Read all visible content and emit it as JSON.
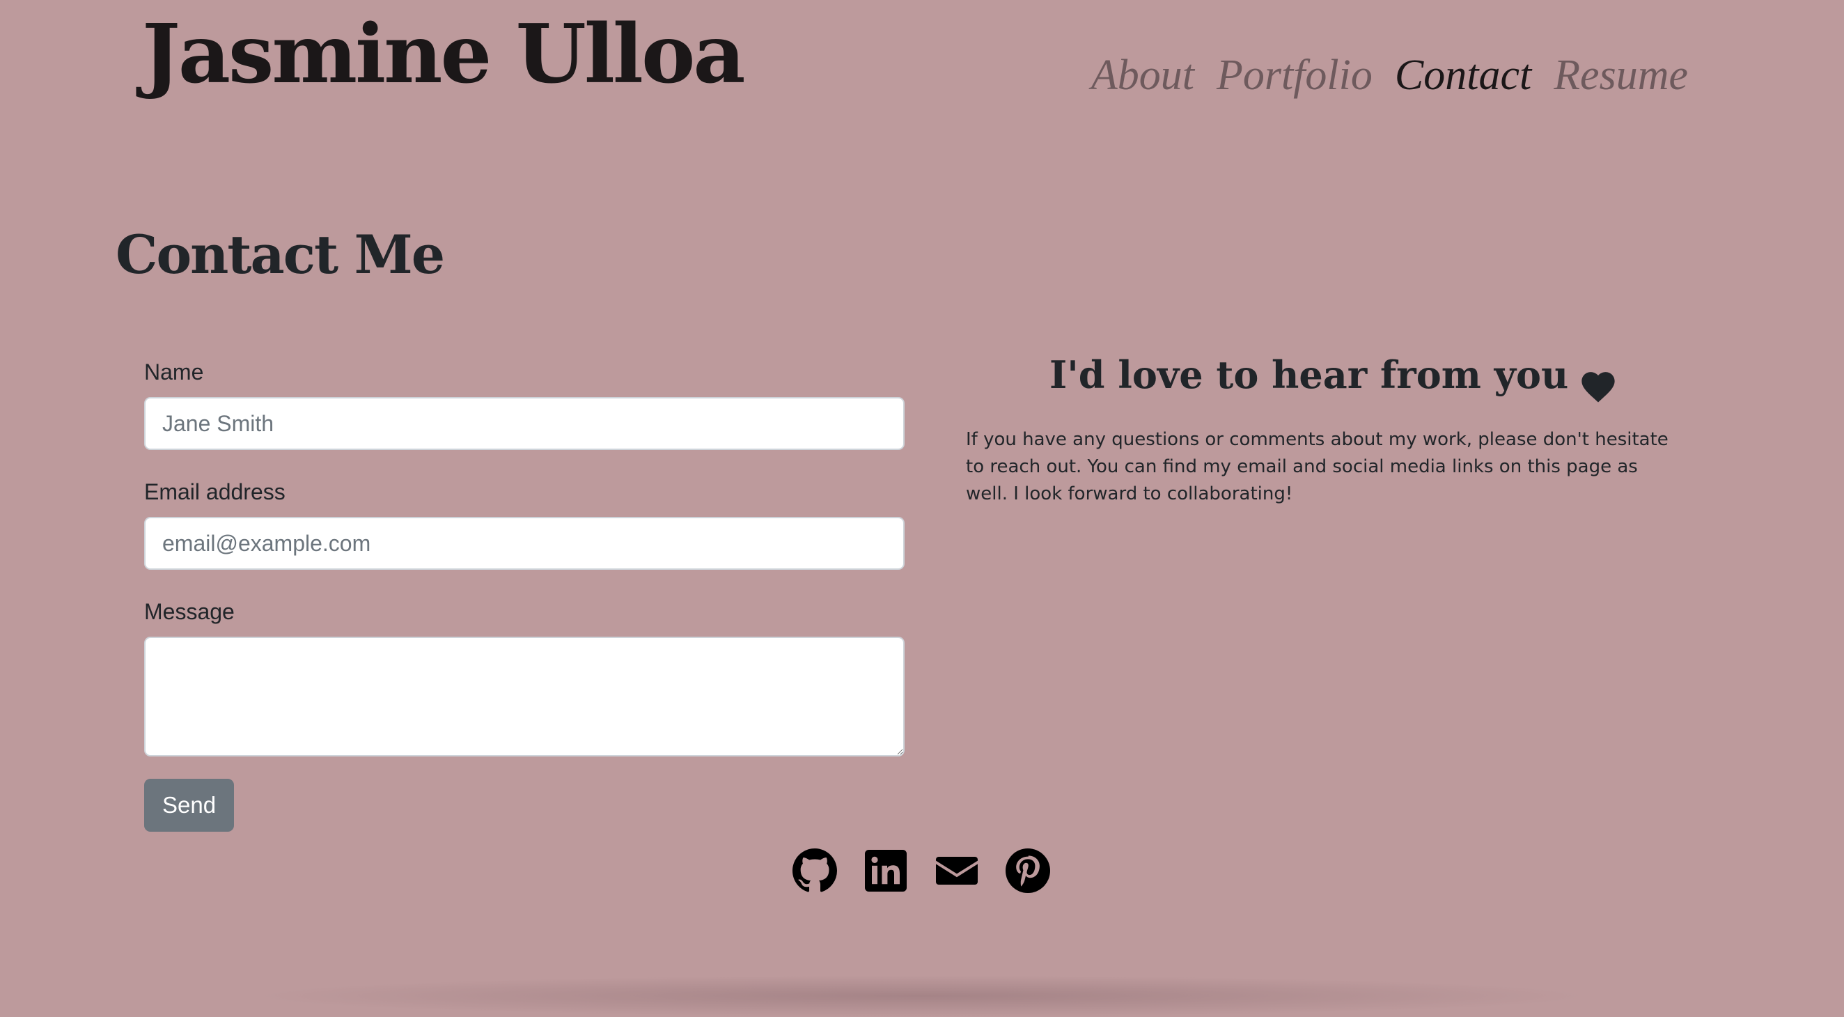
{
  "site": {
    "title": "Jasmine Ulloa"
  },
  "nav": {
    "items": [
      {
        "label": "About",
        "active": false
      },
      {
        "label": "Portfolio",
        "active": false
      },
      {
        "label": "Contact",
        "active": true
      },
      {
        "label": "Resume",
        "active": false
      }
    ]
  },
  "page": {
    "heading": "Contact Me"
  },
  "form": {
    "name_label": "Name",
    "name_placeholder": "Jane Smith",
    "email_label": "Email address",
    "email_placeholder": "email@example.com",
    "message_label": "Message",
    "message_value": "",
    "send_label": "Send"
  },
  "info": {
    "heading": "I'd love to hear from you",
    "heading_icon": "heart-icon",
    "body": "If you have any questions or comments about my work, please don't hesitate to reach out. You can find my email and social media links on this page as well. I look forward to collaborating!"
  },
  "social": {
    "icons": [
      "github-icon",
      "linkedin-icon",
      "envelope-icon",
      "pinterest-icon"
    ]
  },
  "colors": {
    "background": "#bd9a9c",
    "button": "#6c757d",
    "text": "#212529"
  }
}
